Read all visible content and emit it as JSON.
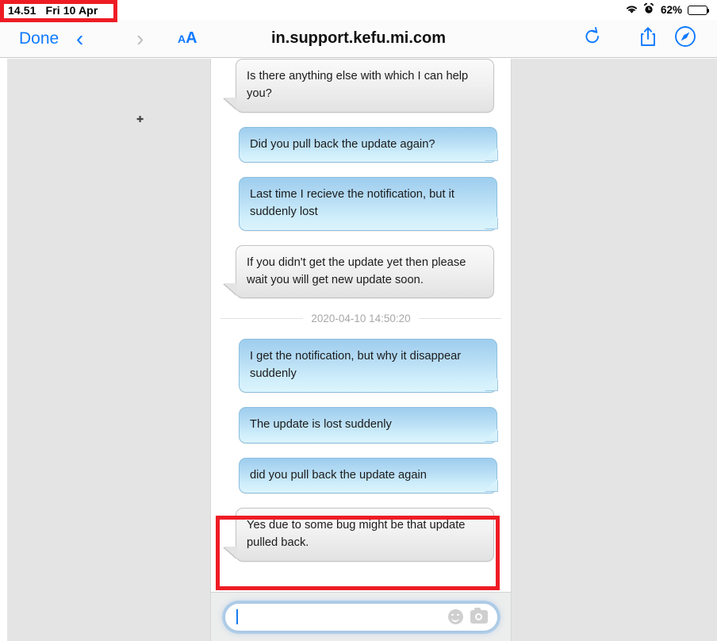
{
  "status_bar": {
    "time": "14.51",
    "date": "Fri 10 Apr",
    "wifi_icon": "wifi-icon",
    "alarm_icon": "alarm-clock-icon",
    "battery_percent": "62%",
    "battery_level": 62
  },
  "toolbar": {
    "done_label": "Done",
    "back_icon": "chevron-left-icon",
    "forward_icon": "chevron-right-icon",
    "text_size_small": "A",
    "text_size_large": "A",
    "url": "in.support.kefu.mi.com",
    "reload_icon": "reload-icon",
    "share_icon": "share-icon",
    "compass_icon": "safari-compass-icon"
  },
  "chat": {
    "messages": [
      {
        "sender": "agent",
        "text": "Is there anything else with which I can help you?"
      },
      {
        "sender": "user",
        "text": "Did you pull back the update again?"
      },
      {
        "sender": "user",
        "text": "Last time I recieve the notification, but it suddenly lost"
      },
      {
        "sender": "agent",
        "text": "If you didn't get the update yet then please wait you will get new update soon."
      },
      {
        "sender": "divider",
        "text": "2020-04-10 14:50:20"
      },
      {
        "sender": "user",
        "text": "I get the notification, but why it disappear suddenly"
      },
      {
        "sender": "user",
        "text": "The update is lost suddenly"
      },
      {
        "sender": "user",
        "text": "did you pull back the update again"
      },
      {
        "sender": "agent",
        "text": "Yes due to some bug might be that update pulled back."
      }
    ]
  },
  "composer": {
    "value": "",
    "placeholder": "",
    "emoji_icon": "emoji-smiley-icon",
    "camera_icon": "camera-icon"
  },
  "annotations": {
    "color": "#ee1c25",
    "clock_box_label": "status-bar-clock-highlight",
    "bubble_box_label": "last-agent-message-highlight"
  }
}
